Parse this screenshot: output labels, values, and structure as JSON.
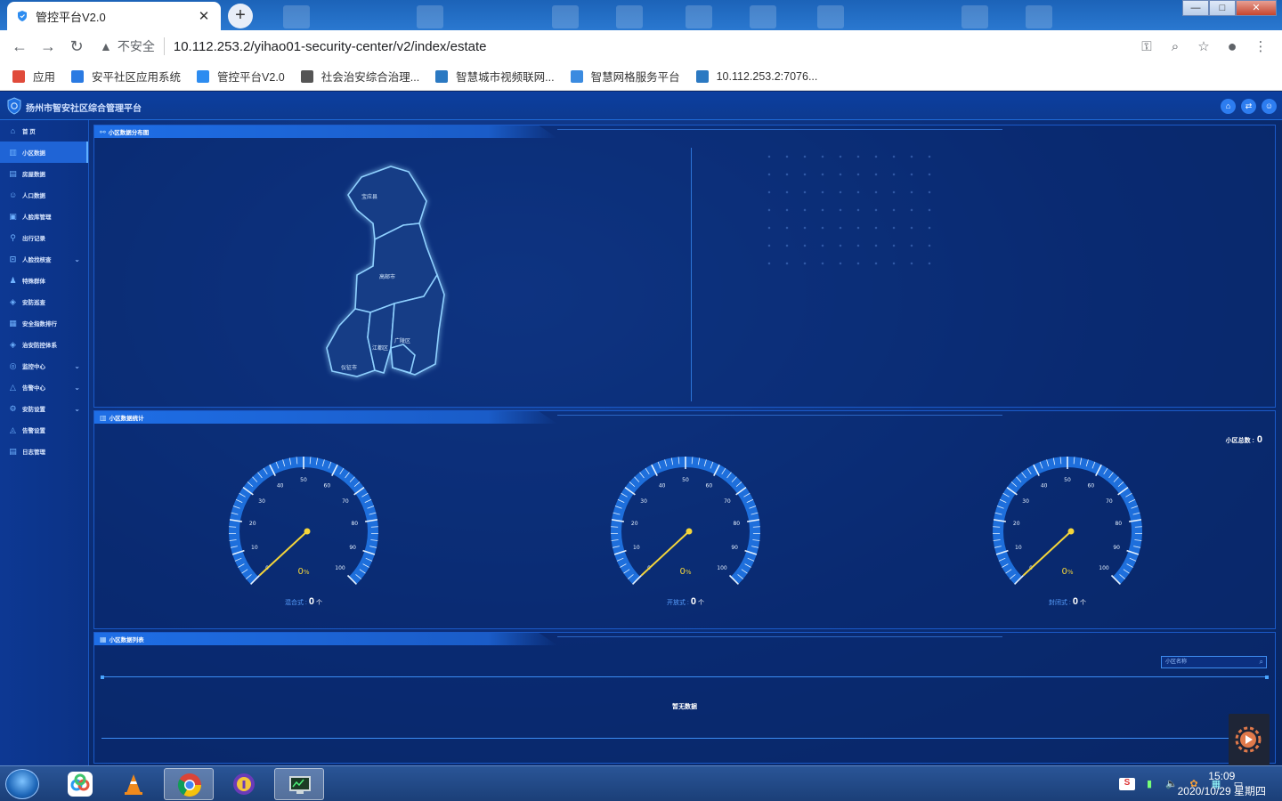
{
  "browser": {
    "tab_title": "管控平台V2.0",
    "tab_close": "✕",
    "new_tab": "+",
    "insecure_label": "不安全",
    "url": "10.112.253.2/yihao01-security-center/v2/index/estate",
    "window_controls": {
      "minimize": "—",
      "maximize": "□",
      "close": "✕"
    }
  },
  "bookmarks": [
    {
      "label": "应用",
      "icon": "apps-grid-icon",
      "color": "#e04b3b"
    },
    {
      "label": "安平社区应用系统",
      "icon": "w-logo-icon",
      "color": "#2a7ae2"
    },
    {
      "label": "管控平台V2.0",
      "icon": "shield-icon",
      "color": "#2d8cf0"
    },
    {
      "label": "社会治安综合治理...",
      "icon": "globe-icon",
      "color": "#555555"
    },
    {
      "label": "智慧城市视频联网...",
      "icon": "c-logo-icon",
      "color": "#2b79c2"
    },
    {
      "label": "智慧网格服务平台",
      "icon": "snowflake-icon",
      "color": "#3b8be0"
    },
    {
      "label": "10.112.253.2:7076...",
      "icon": "c-logo-icon",
      "color": "#2b79c2"
    }
  ],
  "app": {
    "title": "扬州市智安社区综合管理平台",
    "header_buttons": [
      "home-icon",
      "swap-icon",
      "user-icon"
    ]
  },
  "sidebar": {
    "items": [
      {
        "label": "首 页",
        "icon": "home-icon",
        "glyph": "⌂",
        "active": false,
        "expandable": false
      },
      {
        "label": "小区数据",
        "icon": "building-icon",
        "glyph": "▥",
        "active": true,
        "expandable": false
      },
      {
        "label": "房屋数据",
        "icon": "house-icon",
        "glyph": "▤",
        "active": false,
        "expandable": false
      },
      {
        "label": "人口数据",
        "icon": "people-icon",
        "glyph": "☺",
        "active": false,
        "expandable": false
      },
      {
        "label": "人脸库管理",
        "icon": "face-id-icon",
        "glyph": "▣",
        "active": false,
        "expandable": false
      },
      {
        "label": "出行记录",
        "icon": "walk-icon",
        "glyph": "⚲",
        "active": false,
        "expandable": false
      },
      {
        "label": "人脸找核查",
        "icon": "face-scan-icon",
        "glyph": "⊡",
        "active": false,
        "expandable": true
      },
      {
        "label": "特殊群体",
        "icon": "person-icon",
        "glyph": "♟",
        "active": false,
        "expandable": false
      },
      {
        "label": "安防巡查",
        "icon": "shield-icon",
        "glyph": "◈",
        "active": false,
        "expandable": false
      },
      {
        "label": "安全指数排行",
        "icon": "bar-chart-icon",
        "glyph": "▦",
        "active": false,
        "expandable": false
      },
      {
        "label": "治安防控体系",
        "icon": "shield-check-icon",
        "glyph": "◈",
        "active": false,
        "expandable": false
      },
      {
        "label": "监控中心",
        "icon": "camera-icon",
        "glyph": "◎",
        "active": false,
        "expandable": true
      },
      {
        "label": "告警中心",
        "icon": "warning-icon",
        "glyph": "△",
        "active": false,
        "expandable": true
      },
      {
        "label": "安防设置",
        "icon": "settings-icon",
        "glyph": "⚙",
        "active": false,
        "expandable": true
      },
      {
        "label": "告警设置",
        "icon": "bell-icon",
        "glyph": "◬",
        "active": false,
        "expandable": false
      },
      {
        "label": "日志管理",
        "icon": "log-icon",
        "glyph": "▤",
        "active": false,
        "expandable": false
      }
    ],
    "chevron": "⌄"
  },
  "panels": {
    "distribution": {
      "title": "小区数据分布图",
      "map_regions": [
        "宝应县",
        "高邮市",
        "江都区",
        "广陵区",
        "仪征市"
      ]
    },
    "stats": {
      "title": "小区数据统计",
      "total_label": "小区总数 :",
      "total_value": "0",
      "gauges": [
        {
          "label": "混合式 :",
          "count": "0",
          "unit": "个",
          "percent": "0",
          "percent_unit": "%",
          "value": 0
        },
        {
          "label": "开放式 :",
          "count": "0",
          "unit": "个",
          "percent": "0",
          "percent_unit": "%",
          "value": 0
        },
        {
          "label": "封闭式 :",
          "count": "0",
          "unit": "个",
          "percent": "0",
          "percent_unit": "%",
          "value": 0
        }
      ],
      "gauge_ticks": [
        "0",
        "10",
        "20",
        "30",
        "40",
        "50",
        "60",
        "70",
        "80",
        "90",
        "100"
      ]
    },
    "list": {
      "title": "小区数据列表",
      "search_placeholder": "小区名称",
      "empty_text": "暂无数据"
    }
  },
  "taskbar": {
    "time": "15:09",
    "date": "2020/10/29 星期四",
    "apps": [
      "baidu-netdisk-icon",
      "vlc-icon",
      "chrome-icon",
      "security-app-icon",
      "remote-desktop-icon"
    ]
  }
}
